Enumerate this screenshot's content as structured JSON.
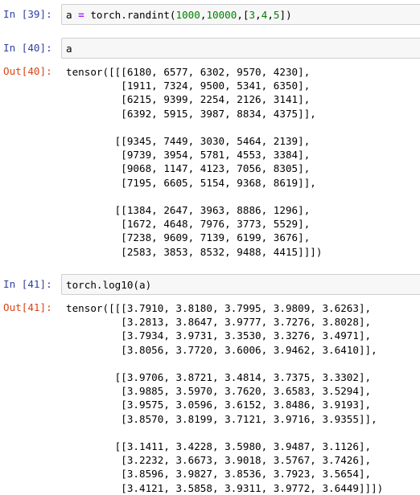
{
  "cells": [
    {
      "in_prompt": "In [39]:",
      "code_parts": {
        "var": "a ",
        "eq": "=",
        "call": " torch.randint(",
        "n1": "1000",
        "c1": ",",
        "n2": "10000",
        "c2": ",[",
        "n3": "3",
        "c3": ",",
        "n4": "4",
        "c4": ",",
        "n5": "5",
        "end": "])"
      }
    },
    {
      "in_prompt": "In [40]:",
      "code": "a",
      "out_prompt": "Out[40]:",
      "output": "tensor([[[6180, 6577, 6302, 9570, 4230],\n         [1911, 7324, 9500, 5341, 6350],\n         [6215, 9399, 2254, 2126, 3141],\n         [6392, 5915, 3987, 8834, 4375]],\n\n        [[9345, 7449, 3030, 5464, 2139],\n         [9739, 3954, 5781, 4553, 3384],\n         [9068, 1147, 4123, 7056, 8305],\n         [7195, 6605, 5154, 9368, 8619]],\n\n        [[1384, 2647, 3963, 8886, 1296],\n         [1672, 4648, 7976, 3773, 5529],\n         [7238, 9609, 7139, 6199, 3676],\n         [2583, 3853, 8532, 9488, 4415]]])"
    },
    {
      "in_prompt": "In [41]:",
      "code": "torch.log10(a)",
      "out_prompt": "Out[41]:",
      "output": "tensor([[[3.7910, 3.8180, 3.7995, 3.9809, 3.6263],\n         [3.2813, 3.8647, 3.9777, 3.7276, 3.8028],\n         [3.7934, 3.9731, 3.3530, 3.3276, 3.4971],\n         [3.8056, 3.7720, 3.6006, 3.9462, 3.6410]],\n\n        [[3.9706, 3.8721, 3.4814, 3.7375, 3.3302],\n         [3.9885, 3.5970, 3.7620, 3.6583, 3.5294],\n         [3.9575, 3.0596, 3.6152, 3.8486, 3.9193],\n         [3.8570, 3.8199, 3.7121, 3.9716, 3.9355]],\n\n        [[3.1411, 3.4228, 3.5980, 3.9487, 3.1126],\n         [3.2232, 3.6673, 3.9018, 3.5767, 3.7426],\n         [3.8596, 3.9827, 3.8536, 3.7923, 3.5654],\n         [3.4121, 3.5858, 3.9311, 3.9772, 3.6449]]])"
    }
  ]
}
